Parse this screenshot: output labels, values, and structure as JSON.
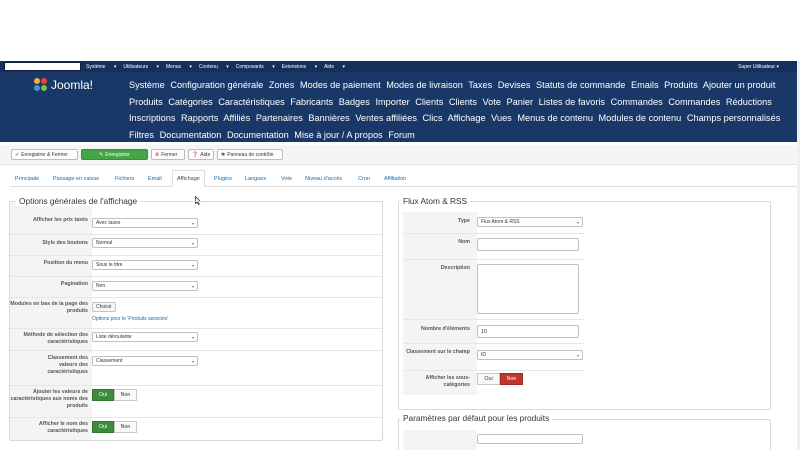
{
  "topbar": {
    "menus": [
      "Système",
      "Utilisateurs",
      "Menus",
      "Contenu",
      "Composants",
      "Extensions",
      "Aide"
    ],
    "user": "Super Utilisateur"
  },
  "header": {
    "logo_text": "Joomla!",
    "submenu": [
      "Système",
      "Configuration générale",
      "Zones",
      "Modes de paiement",
      "Modes de livraison",
      "Taxes",
      "Devises",
      "Statuts de commande",
      "Emails",
      "Produits",
      "Ajouter un produit",
      "Produits",
      "Catégories",
      "Caractéristiques",
      "Fabricants",
      "Badges",
      "Importer",
      "Clients",
      "Clients",
      "Vote",
      "Panier",
      "Listes de favoris",
      "Commandes",
      "Commandes",
      "Réductions",
      "Inscriptions",
      "Rapports",
      "Affiliés",
      "Partenaires",
      "Bannières",
      "Ventes affiliées",
      "Clics",
      "Affichage",
      "Vues",
      "Menus de contenu",
      "Modules de contenu",
      "Champs personnalisés",
      "Filtres",
      "Documentation",
      "Documentation",
      "Mise à jour / A propos",
      "Forum"
    ]
  },
  "toolbar": {
    "save_close": "Enregistrer & Fermer",
    "save": "Enregistrer",
    "close": "Fermer",
    "help": "Aide",
    "control_panel": "Panneau de contrôle"
  },
  "tabs": [
    "Principale",
    "Passage en caisse",
    "Fichiers",
    "Email",
    "Affichage",
    "Plugins",
    "Langues",
    "Vote",
    "Niveau d'accès",
    "Cron",
    "Affiliation"
  ],
  "display_options": {
    "legend": "Options générales de l'affichage",
    "show_prices": {
      "label": "Afficher les prix taxés",
      "value": "Avec taxes"
    },
    "button_style": {
      "label": "Style des boutons",
      "value": "Normal"
    },
    "menu_position": {
      "label": "Position du menu",
      "value": "Sous le titre"
    },
    "pagination": {
      "label": "Pagination",
      "value": "Non"
    },
    "modules_bottom": {
      "label": "Modules en bas de la page des produits",
      "button": "Choisir",
      "link": "Options pour le 'Produits associés'"
    },
    "selection_method": {
      "label": "Méthode de sélection des caractéristiques",
      "value": "Liste déroulante"
    },
    "ranking": {
      "label": "Classement des valeurs des caractéristiques",
      "value": "Classement"
    },
    "add_values": {
      "label": "Ajouter les valeurs de caractéristiques aux noms des produits",
      "yes": "Oui",
      "no": "Non"
    },
    "show_name": {
      "label": "Afficher le nom des caractéristiques",
      "yes": "Oui",
      "no": "Non"
    }
  },
  "rss": {
    "legend": "Flux Atom & RSS",
    "type": {
      "label": "Type",
      "value": "Flux Atom & RSS"
    },
    "name": {
      "label": "Nom",
      "value": ""
    },
    "description": {
      "label": "Description"
    },
    "count": {
      "label": "Nombre d'éléments",
      "value": "10"
    },
    "order": {
      "label": "Classement sur le champ",
      "value": "ID"
    },
    "subcats": {
      "label": "Afficher les sous-catégories",
      "yes": "Oui",
      "no": "Non"
    }
  },
  "product_defaults": {
    "legend": "Paramètres par défaut pour les produits"
  },
  "colors": {
    "topbar": "#16305c",
    "header": "#1a3867",
    "accent_green": "#46a546",
    "accent_red": "#bd362f",
    "link": "#1a6aa8"
  }
}
